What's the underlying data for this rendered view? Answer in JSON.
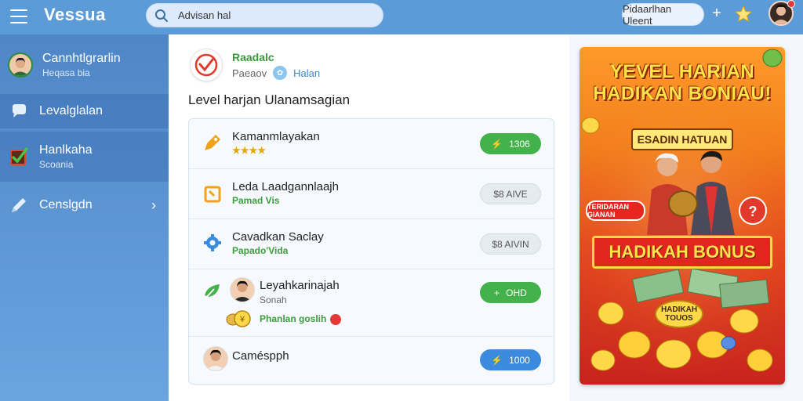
{
  "header": {
    "app_name": "Vessua",
    "search_value": "Advisan hal",
    "action_button": "Pidaarlhan Uleent",
    "plus_label": "+"
  },
  "sidebar": {
    "items": [
      {
        "title": "Cannhtlgrarlin",
        "subtitle": "Heqasa bia"
      },
      {
        "title": "Levalglalan",
        "subtitle": ""
      },
      {
        "title": "Hanlkaha",
        "subtitle": "Scoania"
      },
      {
        "title": "Censlgdn",
        "subtitle": ""
      }
    ]
  },
  "main": {
    "brand_title": "Raadalc",
    "brand_sub": "Paeaov",
    "brand_sub_link": "Halan",
    "section_title": "Level harjan Ulanamsagian",
    "rows": [
      {
        "title": "Kamanmlayakan",
        "subtitle": "★★★★",
        "button": "1306",
        "button_style": "green"
      },
      {
        "title": "Leda Laadgannlaajh",
        "subtitle": "Pamad Vis",
        "button": "$8 AIVE",
        "button_style": "gray"
      },
      {
        "title": "Cavadkan Saclay",
        "subtitle": "Papado'Vida",
        "button": "$8 AIVIN",
        "button_style": "gray"
      },
      {
        "title": "Leyahkarinajah",
        "subtitle": "Sonah",
        "extra": "Phanlan goslih",
        "button": "OHD",
        "button_style": "green"
      },
      {
        "title": "Caméspph",
        "subtitle": "",
        "button": "1000",
        "button_style": "blue"
      }
    ]
  },
  "promo": {
    "headline_1": "YEVEL HARIAN",
    "headline_2": "HADIKAN BONIAU!",
    "tag": "ESADIN HATUAN",
    "bubble": "TERIDARAN GIANAN",
    "ribbon": "HADIKAH BONUS",
    "coin_label": "HADIKAH TOUOS"
  },
  "colors": {
    "topbar": "#5b9bd8",
    "sidebar": "#4f86c6",
    "accent_green": "#43b24a",
    "accent_blue": "#3a8bdd",
    "promo_orange": "#f27d1c",
    "promo_red": "#c8231e"
  }
}
